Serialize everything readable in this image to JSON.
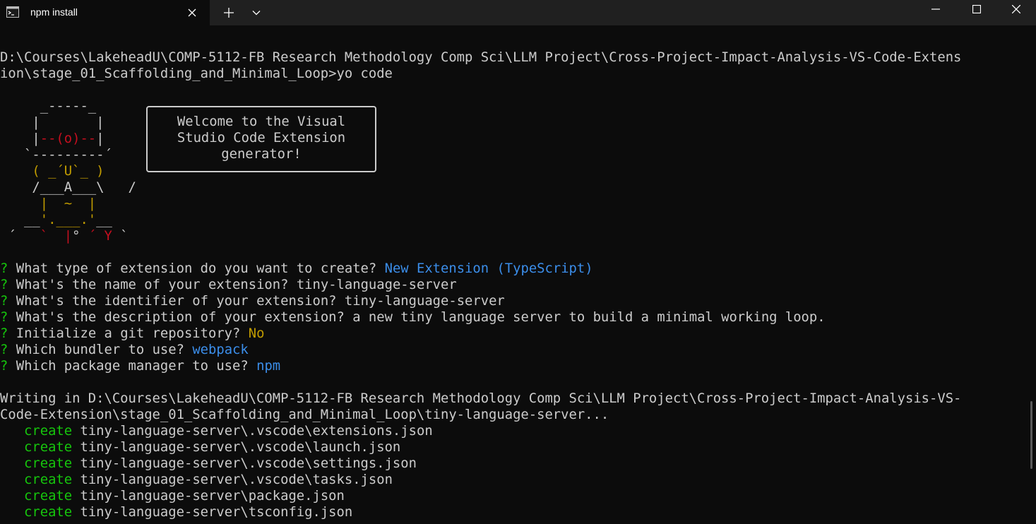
{
  "window": {
    "tab_title": "npm install",
    "icons": {
      "terminal": "terminal-icon",
      "close_tab": "close-icon",
      "new_tab": "plus-icon",
      "dropdown": "chevron-down-icon",
      "minimize": "minimize-icon",
      "maximize": "maximize-icon",
      "close_window": "close-icon"
    }
  },
  "colors": {
    "background": "#0c0c0c",
    "titlebar": "#202020",
    "text": "#cccccc",
    "prompt_marker": "#16c60c",
    "answer": "#3b8eea",
    "yeoman_yellow": "#c19c00",
    "yeoman_red": "#c50f1f"
  },
  "terminal": {
    "command_line_1": "D:\\Courses\\LakeheadU\\COMP-5112-FB Research Methodology Comp Sci\\LLM Project\\Cross-Project-Impact-Analysis-VS-Code-Extens",
    "command_line_2": "ion\\stage_01_Scaffolding_and_Minimal_Loop>yo code",
    "ascii": {
      "l1": "     _-----_     ",
      "l2_a": "    |       |    ",
      "l3_a": "    |",
      "l3_b": "--(o)--",
      "l3_c": "|    ",
      "l4": "   `---------´   ",
      "l5": "    ( _´U`_ )    ",
      "l6": "    /___A___\\   /",
      "l7": "     |  ~  |     ",
      "l8_a": "   __",
      "l8_b": "'.___.'",
      "l8_c": "__   ",
      "l9_a": " ´   ",
      "l9_b": "`  |",
      "l9_c": "° ",
      "l9_d": "´ Y",
      "l9_e": " `"
    },
    "bubble": {
      "line1": "Welcome to the Visual",
      "line2": "Studio Code Extension",
      "line3": "generator!"
    },
    "questions": [
      {
        "marker": "?",
        "question": "What type of extension do you want to create?",
        "answer": "New Extension (TypeScript)"
      },
      {
        "marker": "?",
        "question": "What's the name of your extension?",
        "answer": "tiny-language-server"
      },
      {
        "marker": "?",
        "question": "What's the identifier of your extension?",
        "answer": "tiny-language-server"
      },
      {
        "marker": "?",
        "question": "What's the description of your extension?",
        "answer": "a new tiny language server to build a minimal working loop."
      },
      {
        "marker": "?",
        "question": "Initialize a git repository?",
        "answer": "No"
      },
      {
        "marker": "?",
        "question": "Which bundler to use?",
        "answer": "webpack"
      },
      {
        "marker": "?",
        "question": "Which package manager to use?",
        "answer": "npm"
      }
    ],
    "writing_line_1": "Writing in D:\\Courses\\LakeheadU\\COMP-5112-FB Research Methodology Comp Sci\\LLM Project\\Cross-Project-Impact-Analysis-VS-",
    "writing_line_2": "Code-Extension\\stage_01_Scaffolding_and_Minimal_Loop\\tiny-language-server...",
    "creates": [
      {
        "verb": "create",
        "path": "tiny-language-server\\.vscode\\extensions.json"
      },
      {
        "verb": "create",
        "path": "tiny-language-server\\.vscode\\launch.json"
      },
      {
        "verb": "create",
        "path": "tiny-language-server\\.vscode\\settings.json"
      },
      {
        "verb": "create",
        "path": "tiny-language-server\\.vscode\\tasks.json"
      },
      {
        "verb": "create",
        "path": "tiny-language-server\\package.json"
      },
      {
        "verb": "create",
        "path": "tiny-language-server\\tsconfig.json"
      }
    ]
  }
}
